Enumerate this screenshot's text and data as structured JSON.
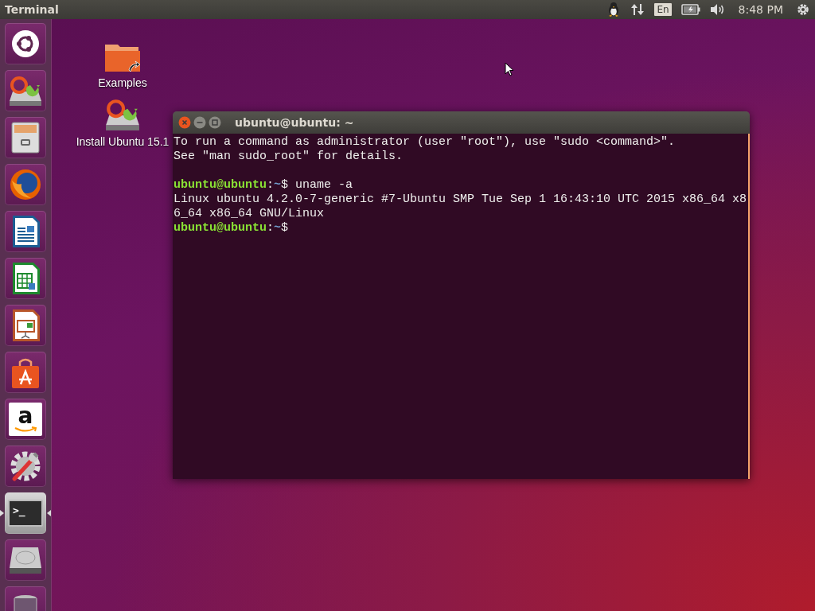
{
  "top_bar": {
    "app_title": "Terminal",
    "keyboard_layout": "En",
    "clock": "8:48 PM"
  },
  "launcher": [
    {
      "kind": "dash",
      "active": false
    },
    {
      "kind": "installer",
      "active": false
    },
    {
      "kind": "files",
      "active": false
    },
    {
      "kind": "browser",
      "active": false
    },
    {
      "kind": "writer",
      "active": false
    },
    {
      "kind": "calc",
      "active": false
    },
    {
      "kind": "impress",
      "active": false
    },
    {
      "kind": "store",
      "active": false
    },
    {
      "kind": "amazon",
      "glyph": "a",
      "active": false
    },
    {
      "kind": "settings",
      "active": false
    },
    {
      "kind": "terminal",
      "glyph": ">_",
      "active": true
    },
    {
      "kind": "disk",
      "active": false
    },
    {
      "kind": "trash",
      "active": false
    }
  ],
  "desktop_icons": [
    {
      "kind": "folder",
      "label": "Examples"
    },
    {
      "kind": "installer",
      "label": "Install Ubuntu 15.1"
    }
  ],
  "terminal": {
    "title": "ubuntu@ubuntu: ~",
    "lines": [
      {
        "kind": "output",
        "text": "To run a command as administrator (user \"root\"), use \"sudo <command>\"."
      },
      {
        "kind": "output",
        "text": "See \"man sudo_root\" for details."
      },
      {
        "kind": "blank"
      },
      {
        "kind": "prompt",
        "user": "ubuntu@ubuntu",
        "colon": ":",
        "path": "~",
        "command": "$ uname -a"
      },
      {
        "kind": "output",
        "text": "Linux ubuntu 4.2.0-7-generic #7-Ubuntu SMP Tue Sep 1 16:43:10 UTC 2015 x86_64 x8"
      },
      {
        "kind": "output",
        "text": "6_64 x86_64 GNU/Linux"
      },
      {
        "kind": "prompt",
        "user": "ubuntu@ubuntu",
        "colon": ":",
        "path": "~",
        "command": "$"
      }
    ]
  }
}
